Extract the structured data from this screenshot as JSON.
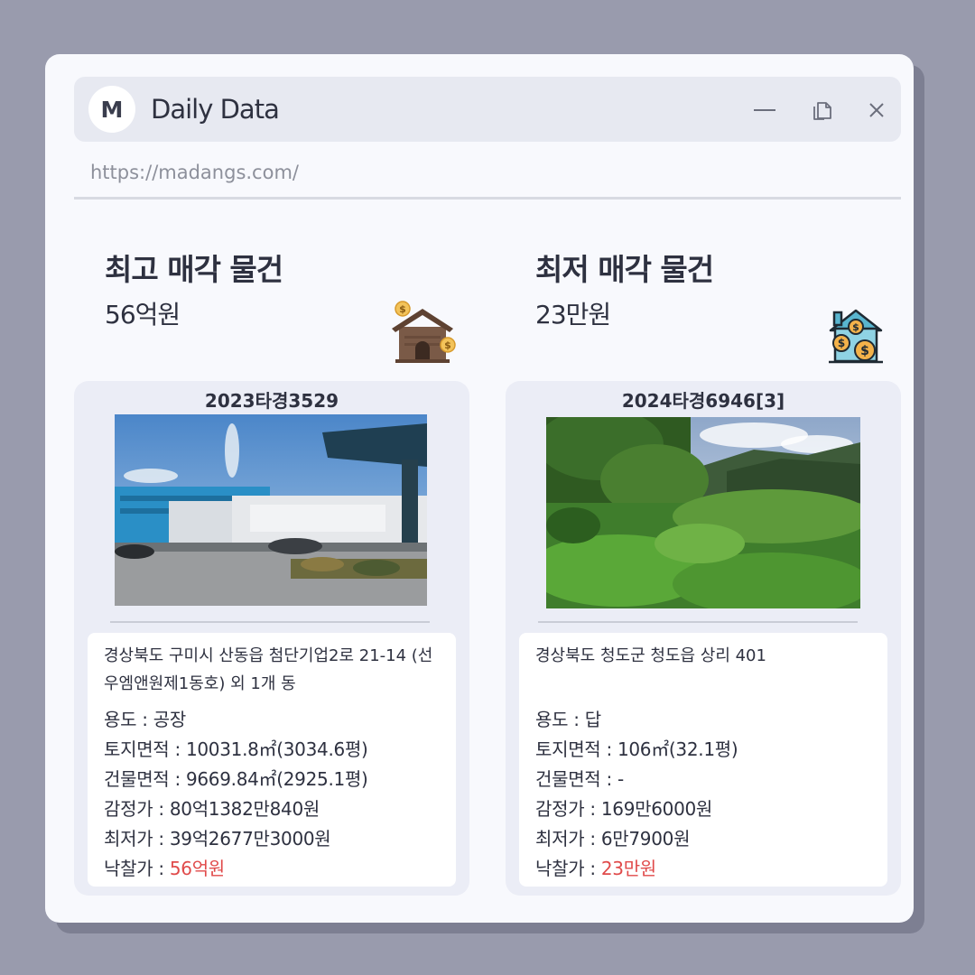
{
  "window": {
    "logo_letter": "M",
    "title": "Daily Data",
    "url": "https://madangs.com/"
  },
  "highest": {
    "heading": "최고 매각 물건",
    "price": "56억원",
    "case_no": "2023타경3529",
    "address": "경상북도 구미시 산동읍 첨단기업2로 21-14 (선우엠앤원제1동호) 외 1개 동",
    "use_label": "용도 : ",
    "use": "공장",
    "land_label": "토지면적 : ",
    "land": "10031.8㎡(3034.6평)",
    "building_label": "건물면적 : ",
    "building": "9669.84㎡(2925.1평)",
    "appraisal_label": "감정가 : ",
    "appraisal": "80억1382만840원",
    "minimum_label": "최저가 : ",
    "minimum": "39억2677만3000원",
    "winning_label": "낙찰가 : ",
    "winning": "56억원"
  },
  "lowest": {
    "heading": "최저 매각 물건",
    "price": "23만원",
    "case_no": "2024타경6946[3]",
    "address": "경상북도 청도군 청도읍 상리 401",
    "use_label": "용도 : ",
    "use": "답",
    "land_label": "토지면적 : ",
    "land": "106㎡(32.1평)",
    "building_label": "건물면적 : ",
    "building": "-",
    "appraisal_label": "감정가 : ",
    "appraisal": "169만6000원",
    "minimum_label": "최저가 : ",
    "minimum": "6만7900원",
    "winning_label": "낙찰가 : ",
    "winning": "23만원"
  },
  "colors": {
    "accent_red": "#e04a4a",
    "background": "#999bad",
    "window": "#f8f9fd",
    "card": "#ebedf6"
  },
  "icons": [
    "minimize-icon",
    "copy-icon",
    "close-icon",
    "house-money-icon",
    "house-coins-icon"
  ]
}
